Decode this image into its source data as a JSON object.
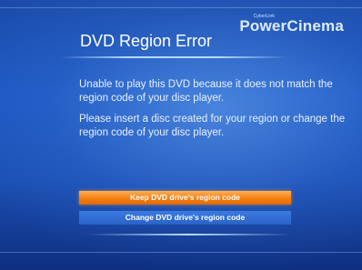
{
  "brand": {
    "small_text": "CyberLink",
    "name": "PowerCinema"
  },
  "dialog": {
    "title": "DVD Region Error",
    "message_1": "Unable to play this DVD because it does not match the region code of your disc player.",
    "message_2": "Please insert a disc created for your region or change the region code of your disc player."
  },
  "buttons": {
    "keep_label": "Keep DVD drive's region code",
    "change_label": "Change DVD drive's region code"
  },
  "colors": {
    "background": "#1b56c0",
    "selected_button": "#f57f12",
    "unselected_button": "#2a63c8",
    "text": "#ffffff"
  }
}
